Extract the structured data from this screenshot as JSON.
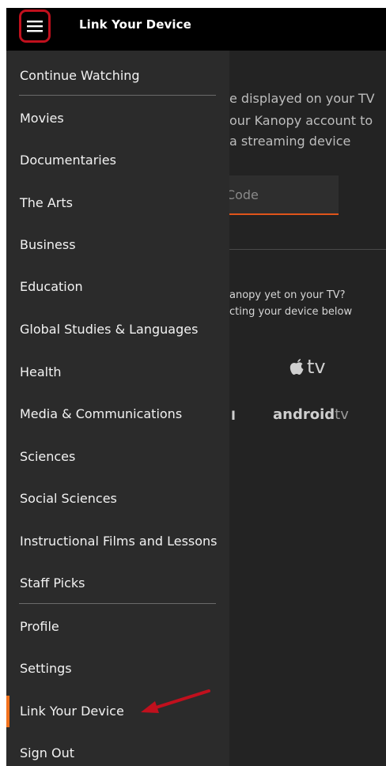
{
  "header": {
    "menu_icon": "hamburger-menu-icon",
    "title": "Link Your Device",
    "highlight_color": "#c0101d"
  },
  "background": {
    "line1": "e displayed on your TV",
    "line2": "our Kanopy account to",
    "line3": "a streaming device",
    "code_placeholder": "nter Code",
    "note_line1": "anopy yet on your TV?",
    "note_line2": "cting your device below",
    "apple_tv": "tv",
    "roku_fragment": "I",
    "android_main": "android",
    "android_tv": "tv"
  },
  "menu": {
    "items": [
      {
        "label": "Continue Watching"
      },
      {
        "label": "Movies"
      },
      {
        "label": "Documentaries"
      },
      {
        "label": "The Arts"
      },
      {
        "label": "Business"
      },
      {
        "label": "Education"
      },
      {
        "label": "Global Studies & Languages"
      },
      {
        "label": "Health"
      },
      {
        "label": "Media & Communications"
      },
      {
        "label": "Sciences"
      },
      {
        "label": "Social Sciences"
      },
      {
        "label": "Instructional Films and Lessons"
      },
      {
        "label": "Staff Picks"
      },
      {
        "label": "Profile"
      },
      {
        "label": "Settings"
      },
      {
        "label": "Link Your Device",
        "active": true
      },
      {
        "label": "Sign Out"
      }
    ],
    "accent_color": "#f2711c"
  },
  "annotation": {
    "arrow_color": "#c0101d"
  }
}
